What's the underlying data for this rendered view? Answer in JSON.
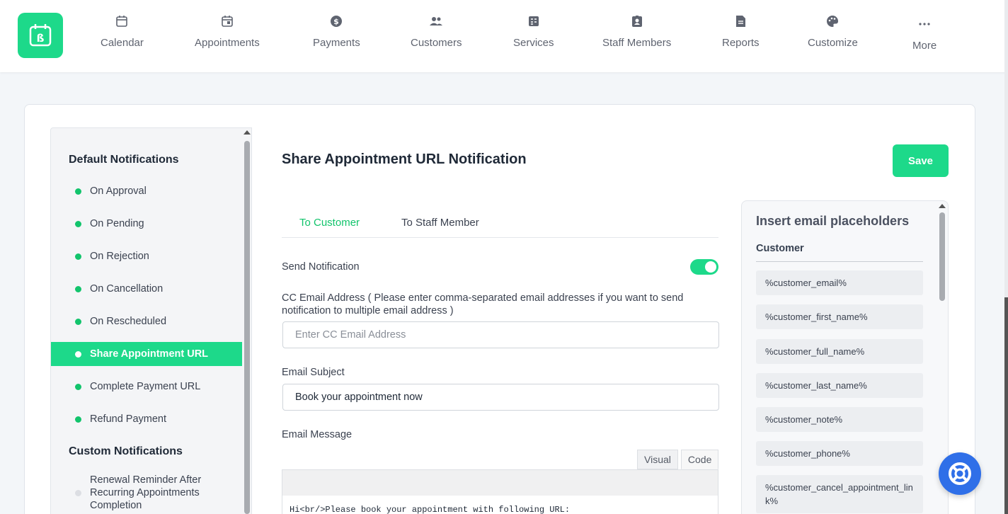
{
  "nav": {
    "items": [
      {
        "label": "Calendar",
        "icon": "calendar-icon"
      },
      {
        "label": "Appointments",
        "icon": "calendar-event-icon"
      },
      {
        "label": "Payments",
        "icon": "dollar-circle-icon"
      },
      {
        "label": "Customers",
        "icon": "users-icon"
      },
      {
        "label": "Services",
        "icon": "services-icon"
      },
      {
        "label": "Staff Members",
        "icon": "staff-badge-icon"
      },
      {
        "label": "Reports",
        "icon": "report-icon"
      },
      {
        "label": "Customize",
        "icon": "palette-icon"
      },
      {
        "label": "More",
        "icon": "more-dots-icon"
      }
    ]
  },
  "sidebar": {
    "default_heading": "Default Notifications",
    "items": [
      {
        "label": "On Approval"
      },
      {
        "label": "On Pending"
      },
      {
        "label": "On Rejection"
      },
      {
        "label": "On Cancellation"
      },
      {
        "label": "On Rescheduled"
      },
      {
        "label": "Share Appointment URL"
      },
      {
        "label": "Complete Payment URL"
      },
      {
        "label": "Refund Payment"
      }
    ],
    "custom_heading": "Custom Notifications",
    "custom_items": [
      {
        "label": "Renewal Reminder After Recurring Appointments Completion"
      }
    ]
  },
  "main": {
    "title": "Share Appointment URL Notification",
    "save_label": "Save",
    "tabs": [
      {
        "label": "To Customer"
      },
      {
        "label": "To Staff Member"
      }
    ],
    "send_notification_label": "Send Notification",
    "send_notification_on": true,
    "cc_label": "CC Email Address ( Please enter comma-separated email addresses if you want to send notification to multiple email address )",
    "cc_placeholder": "Enter CC Email Address",
    "subject_label": "Email Subject",
    "subject_value": "Book your appointment now",
    "message_label": "Email Message",
    "editor_tab_visual": "Visual",
    "editor_tab_code": "Code",
    "message_value": "Hi<br/>Please book your appointment with following URL:"
  },
  "placeholders": {
    "title": "Insert email placeholders",
    "group": "Customer",
    "items": [
      "%customer_email%",
      "%customer_first_name%",
      "%customer_full_name%",
      "%customer_last_name%",
      "%customer_note%",
      "%customer_phone%",
      "%customer_cancel_appointment_link%"
    ]
  },
  "colors": {
    "accent": "#1dd98a",
    "accent_text": "#12c46c",
    "help_button": "#2f6fe8"
  }
}
